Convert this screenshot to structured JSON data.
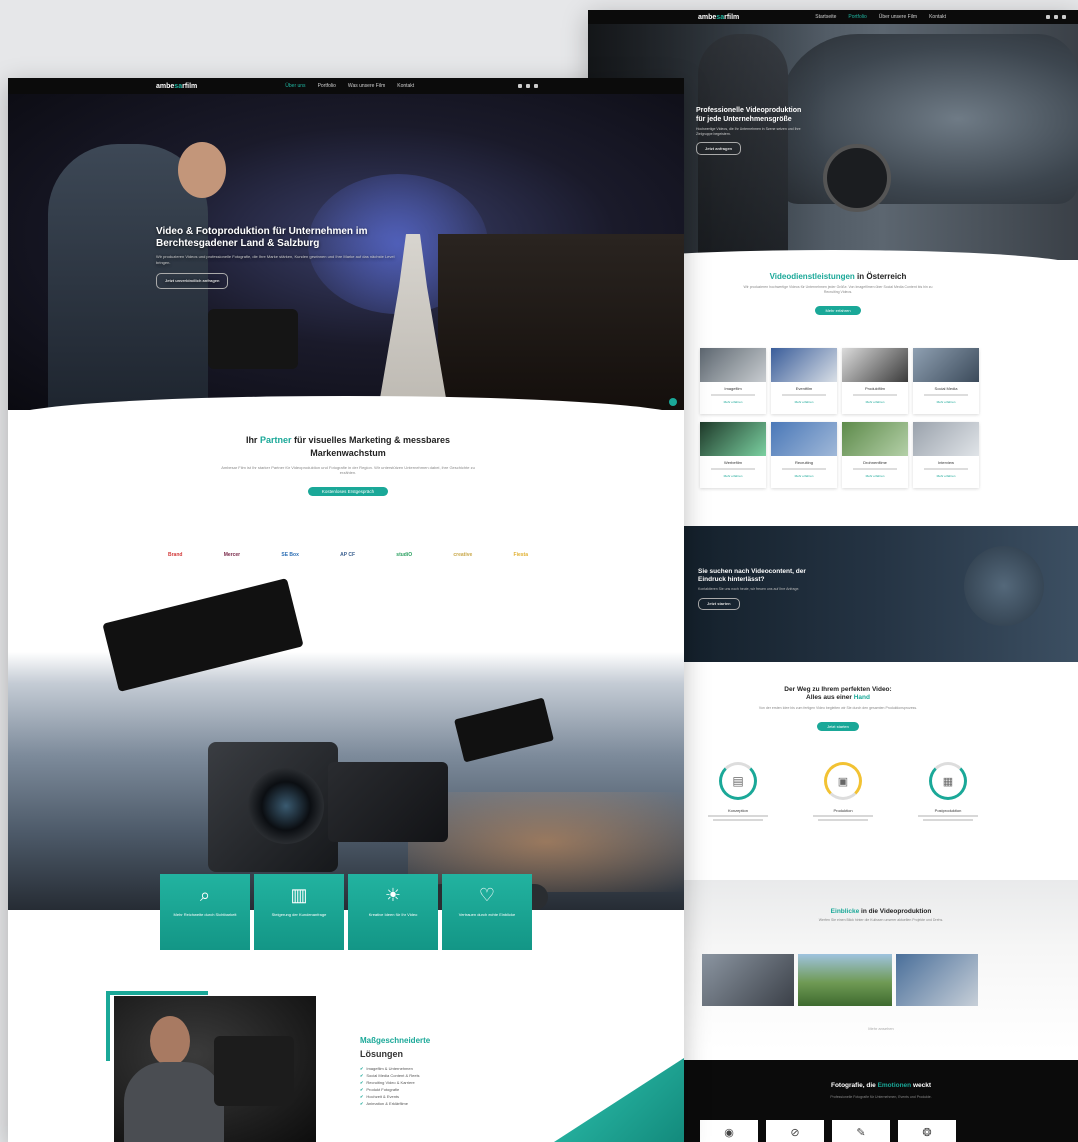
{
  "left": {
    "nav": {
      "logo_a": "ambe",
      "logo_b": "sa",
      "logo_c": "rfilm",
      "items": [
        "Über uns",
        "Portfolio",
        "Was unsere Film",
        "Kontakt"
      ]
    },
    "hero": {
      "title_line1": "Video & Fotoproduktion für Unternehmen im",
      "title_line2": "Berchtesgadener Land & Salzburg",
      "text": "Wir produzieren Videos und professionelle Fotografie, die Ihre Marke stärken, Kunden gewinnen und Ihre Marke auf das nächste Level bringen.",
      "button": "Jetzt unverbindlich anfragen"
    },
    "partner": {
      "pre": "Ihr ",
      "accent": "Partner",
      "post": " für visuelles Marketing & messbares",
      "line2": "Markenwachstum",
      "text": "Ambesar Film ist Ihr starker Partner für Videoproduktion und Fotografie in der Region. Wir unterstützen Unternehmen dabei, ihre Geschichte zu erzählen.",
      "button": "Kostenloses Erstgespräch"
    },
    "logos": [
      "Brand",
      "Mercer",
      "SE Box",
      "AP CF",
      "studiO",
      "creative",
      "Fiesta"
    ],
    "features": [
      {
        "icon": "search-icon",
        "label": "Mehr Reichweite durch Sichtbarkeit"
      },
      {
        "icon": "chart-icon",
        "label": "Steigerung der Kundenanfrage"
      },
      {
        "icon": "lightbulb-icon",
        "label": "Kreative Ideen für Ihr Video"
      },
      {
        "icon": "handshake-icon",
        "label": "Vertrauen durch echte Einblicke"
      }
    ],
    "solutions": {
      "title": "Maßgeschneiderte",
      "subtitle": "Lösungen",
      "list": [
        "Imagefilm & Unternehmen",
        "Social Media Content & Reels",
        "Recruiting Video & Karriere",
        "Produkt Fotografie",
        "Hochzeit & Events",
        "Animation & Erklärfilme"
      ]
    }
  },
  "right": {
    "nav": {
      "logo_a": "ambe",
      "logo_b": "sa",
      "logo_c": "rfilm",
      "items": [
        "Startseite",
        "Portfolio",
        "Über unsere Film",
        "Kontakt"
      ]
    },
    "hero": {
      "title_line1": "Professionelle Videoproduktion",
      "title_line2": "für jede Unternehmensgröße",
      "text": "Hochwertige Videos, die Ihr Unternehmen in Szene setzen und Ihre Zielgruppe begeistern.",
      "button": "Jetzt anfragen"
    },
    "areas": {
      "accent": "Videodienstleistungen",
      "post": " in Österreich",
      "text": "Wir produzieren hochwertige Videos für Unternehmen jeder Größe. Von Imagefilmen über Social Media Content bis hin zu Recruiting Videos.",
      "button": "Mehr erfahren",
      "cards": [
        {
          "title": "Imagefilm",
          "link": "Mehr erfahren"
        },
        {
          "title": "Eventfilm",
          "link": "Mehr erfahren"
        },
        {
          "title": "Produktfilm",
          "link": "Mehr erfahren"
        },
        {
          "title": "Social Media",
          "link": "Mehr erfahren"
        },
        {
          "title": "Werbefilm",
          "link": "Mehr erfahren"
        },
        {
          "title": "Recruiting",
          "link": "Mehr erfahren"
        },
        {
          "title": "Drohnenfilme",
          "link": "Mehr erfahren"
        },
        {
          "title": "Interview",
          "link": "Mehr erfahren"
        }
      ]
    },
    "cta": {
      "line1": "Sie suchen nach Videocontent, der",
      "line2": "Eindruck hinterlässt?",
      "text": "Kontaktieren Sie uns noch heute, wir freuen uns auf Ihre Anfrage.",
      "button": "Jetzt starten"
    },
    "process": {
      "line1": "Der Weg zu Ihrem perfekten Video:",
      "line2_pre": "Alles aus einer ",
      "line2_accent": "Hand",
      "text": "Von der ersten Idee bis zum fertigen Video begleiten wir Sie durch den gesamten Produktionsprozess.",
      "button": "Jetzt starten",
      "steps": [
        {
          "icon": "clipboard-icon",
          "label": "Konzeption"
        },
        {
          "icon": "camera-icon",
          "label": "Produktion"
        },
        {
          "icon": "film-icon",
          "label": "Postproduktion"
        }
      ]
    },
    "insights": {
      "accent": "Einblicke",
      "post": " in die Videoproduktion",
      "text": "Werfen Sie einen Blick hinter die Kulissen unserer aktuellen Projekte und Drehs.",
      "link": "Mehr ansehen"
    },
    "footer": {
      "pre": "Fotografie, die ",
      "accent": "Emotionen",
      "post": " weckt",
      "text": "Professionelle Fotografie für Unternehmen, Events und Produkte.",
      "icons": [
        "eye-icon",
        "no-icon",
        "microphone-icon",
        "camera-icon"
      ]
    }
  }
}
